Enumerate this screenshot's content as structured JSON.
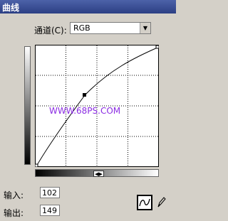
{
  "window": {
    "title": "曲线"
  },
  "channel": {
    "label": "通道(C):",
    "value": "RGB"
  },
  "fields": {
    "input_label": "输入:",
    "input_value": "102",
    "output_label": "输出:",
    "output_value": "149"
  },
  "watermark": "WWW.68PS.COM",
  "colors": {
    "titlebar": "#2c3f84",
    "panel": "#d4d0c8",
    "watermark": "#8a2be2"
  },
  "icons": [
    "dropdown-arrow-icon",
    "slider-arrows-icon",
    "curve-tool-icon",
    "pencil-icon"
  ]
}
